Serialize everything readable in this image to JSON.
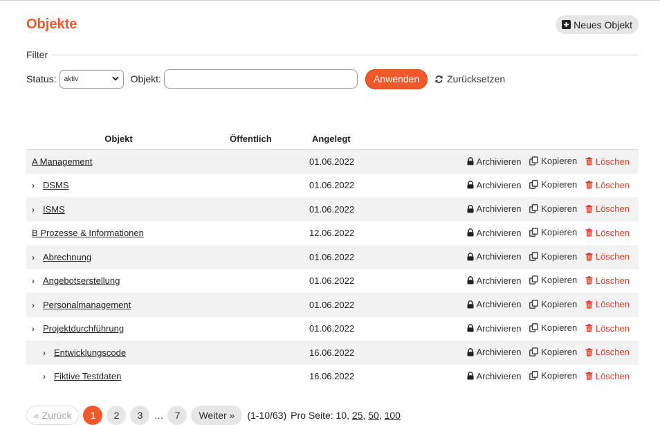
{
  "title": "Objekte",
  "new_button": "Neues Objekt",
  "filter": {
    "legend": "Filter",
    "status_label": "Status:",
    "status_value": "aktiv",
    "objekt_label": "Objekt:",
    "objekt_value": "",
    "apply": "Anwenden",
    "reset": "Zurücksetzen"
  },
  "columns": {
    "objekt": "Objekt",
    "oeffentlich": "Öffentlich",
    "angelegt": "Angelegt"
  },
  "actions": {
    "archive": "Archivieren",
    "copy": "Kopieren",
    "delete": "Löschen"
  },
  "rows": [
    {
      "name": "A Management",
      "date": "01.06.2022",
      "level": 0,
      "expandable": false
    },
    {
      "name": "DSMS",
      "date": "01.06.2022",
      "level": 1,
      "expandable": true
    },
    {
      "name": "ISMS",
      "date": "01.06.2022",
      "level": 1,
      "expandable": true
    },
    {
      "name": "B Prozesse & Informationen",
      "date": "12.06.2022",
      "level": 0,
      "expandable": false
    },
    {
      "name": "Abrechnung",
      "date": "01.06.2022",
      "level": 1,
      "expandable": true
    },
    {
      "name": "Angebotserstellung",
      "date": "01.06.2022",
      "level": 1,
      "expandable": true
    },
    {
      "name": "Personalmanagement",
      "date": "01.06.2022",
      "level": 1,
      "expandable": true
    },
    {
      "name": "Projektdurchführung",
      "date": "01.06.2022",
      "level": 1,
      "expandable": true
    },
    {
      "name": "Entwicklungscode",
      "date": "16.06.2022",
      "level": 2,
      "expandable": true
    },
    {
      "name": "Fiktive Testdaten",
      "date": "16.06.2022",
      "level": 2,
      "expandable": true
    }
  ],
  "pagination": {
    "prev": "« Zurück",
    "pages": [
      "1",
      "2",
      "3"
    ],
    "ellipsis": "…",
    "last": "7",
    "active": "1",
    "next": "Weiter »",
    "count": "(1-10/63)",
    "per_page_label": "Pro Seite:",
    "per_page_current": "10,",
    "per_page_options": [
      "25",
      "50",
      "100"
    ]
  },
  "colors": {
    "accent": "#f0592a",
    "delete": "#d93a2b",
    "row_alt": "#f2f2f2"
  }
}
